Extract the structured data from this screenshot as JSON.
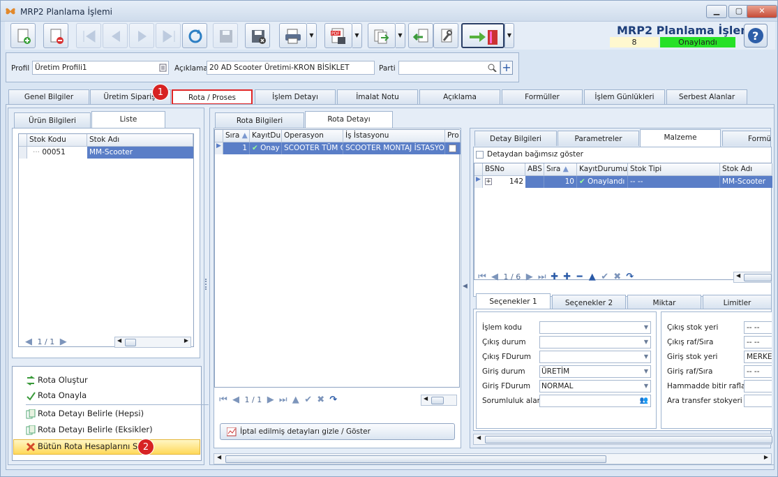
{
  "window": {
    "title": "MRP2 Planlama İşlemi"
  },
  "header": {
    "title": "MRP2 Planlama İşlemi",
    "count": "8",
    "status": "Onaylandı",
    "status_color": "#27e127"
  },
  "toolbar": {
    "icons": [
      "new-document-icon",
      "delete-document-icon",
      "first-record-icon",
      "previous-record-icon",
      "next-record-icon",
      "last-record-icon",
      "refresh-icon",
      "save-icon",
      "save-cancel-icon",
      "print-icon",
      "export-pdf-icon",
      "export-icon",
      "import-icon",
      "tools-icon",
      "exit-door-icon",
      "help-icon"
    ]
  },
  "filter": {
    "profil_label": "Profil",
    "profil_value": "Üretim Profili1",
    "aciklama_label": "Açıklama",
    "aciklama_value": "20 AD Scooter Üretimi-KRON BİSİKLET",
    "parti_label": "Parti",
    "parti_value": ""
  },
  "tabs": [
    "Genel Bilgiler",
    "Üretim Siparişi",
    "Rota / Proses",
    "İşlem Detayı",
    "İmalat Notu",
    "Açıklama",
    "Formüller",
    "İşlem Günlükleri",
    "Serbest Alanlar"
  ],
  "active_tab": "Rota / Proses",
  "left": {
    "subtabs": [
      "Ürün Bilgileri",
      "Liste"
    ],
    "columns": [
      "Stok Kodu",
      "Stok Adı"
    ],
    "rows": [
      {
        "code": "00051",
        "name": "MM-Scooter"
      }
    ],
    "pager": "1 / 1",
    "actions": [
      "Rota Oluştur",
      "Rota Onayla",
      "Rota Detayı Belirle (Hepsi)",
      "Rota Detayı Belirle (Eksikler)",
      "Bütün Rota Hesaplarını Sil"
    ]
  },
  "middle": {
    "subtabs": [
      "Rota Bilgileri",
      "Rota Detayı"
    ],
    "columns": [
      "Sıra",
      "KayıtDur",
      "Operasyon",
      "İş İstasyonu",
      "Pro"
    ],
    "rows": [
      {
        "sira": "1",
        "durum": "Onay",
        "operasyon": "SCOOTER TÜM G",
        "istasyon": "SCOOTER MONTAJ İSTASYON"
      }
    ],
    "pager": "1 / 1",
    "toggle_button": "İptal edilmiş detayları gizle / Göster"
  },
  "right": {
    "subtabs": [
      "Detay Bilgileri",
      "Parametreler",
      "Malzeme",
      "Formü"
    ],
    "checkbox": "Detaydan bağımsız göster",
    "columns": [
      "BSNo",
      "ABS",
      "Sıra",
      "KayıtDurumu",
      "Stok Tipi",
      "Stok Adı"
    ],
    "rows": [
      {
        "bsno": "142",
        "abs": "",
        "sira": "10",
        "durum": "Onaylandı",
        "tip": "-- --",
        "ad": "MM-Scooter"
      }
    ],
    "pager": "1 / 6",
    "option_tabs": [
      "Seçenekler 1",
      "Seçenekler 2",
      "Miktar",
      "Limitler"
    ],
    "form_left": [
      {
        "label": "İşlem kodu",
        "value": ""
      },
      {
        "label": "Çıkış durum",
        "value": ""
      },
      {
        "label": "Çıkış FDurum",
        "value": ""
      },
      {
        "label": "Giriş durum",
        "value": "ÜRETİM"
      },
      {
        "label": "Giriş FDurum",
        "value": "NORMAL"
      },
      {
        "label": "Sorumluluk alanı",
        "value": ""
      }
    ],
    "form_right": [
      {
        "label": "Çıkış stok yeri",
        "value": "-- --"
      },
      {
        "label": "Çıkış raf/Sıra",
        "value": "-- --"
      },
      {
        "label": "Giriş stok yeri",
        "value": "MERKE"
      },
      {
        "label": "Giriş raf/Sıra",
        "value": "-- --"
      },
      {
        "label": "Hammadde bitir raflar",
        "value": ""
      },
      {
        "label": "Ara transfer stokyeri",
        "value": ""
      }
    ]
  },
  "annotations": [
    "1",
    "2"
  ]
}
